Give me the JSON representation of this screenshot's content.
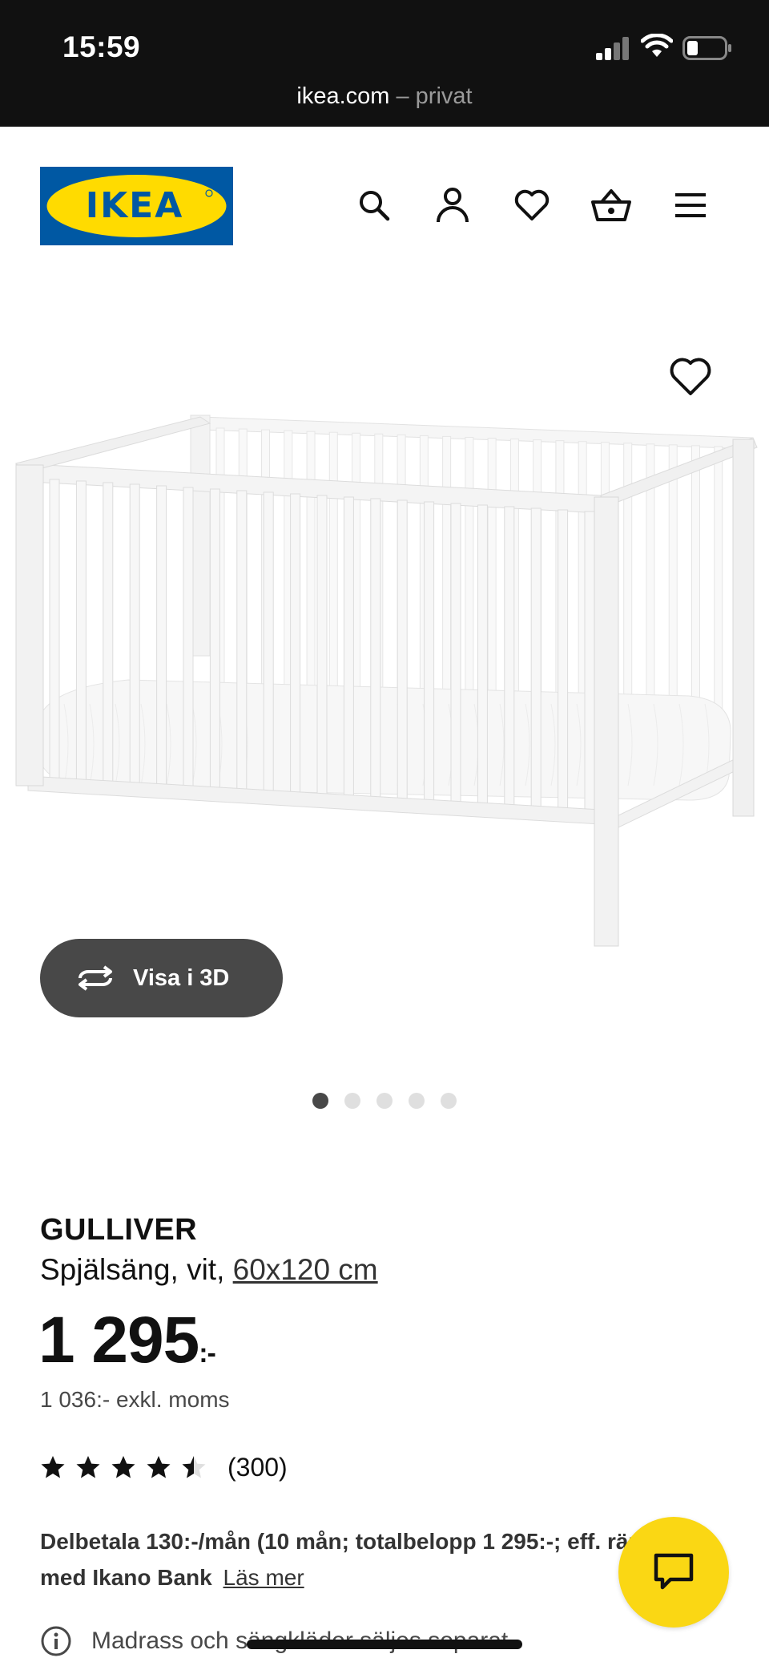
{
  "status_bar": {
    "time": "15:59",
    "url_host": "ikea.com",
    "url_suffix": " – privat",
    "icons": [
      "cell-signal-icon",
      "wifi-icon",
      "battery-icon"
    ]
  },
  "header": {
    "logo_text": "IKEA",
    "icons": [
      "search-icon",
      "user-icon",
      "heart-icon",
      "basket-icon",
      "menu-icon"
    ]
  },
  "gallery": {
    "view_3d_label": "Visa i 3D",
    "slide_count": 5,
    "active_slide": 1
  },
  "product": {
    "name": "GULLIVER",
    "description": "Spjälsäng, vit,",
    "size_link": "60x120 cm",
    "price": "1 295",
    "price_suffix": ":-",
    "price_excl_vat": "1 036:- exkl. moms",
    "rating_stars": 4.5,
    "rating_max": 5,
    "review_count": "(300)",
    "financing_text": "Delbetala 130:-/mån (10 mån; totalbelopp 1 295:-; eff. ränta 0%) med Ikano Bank",
    "financing_link": "Läs mer",
    "note": "Madrass och sängkläder säljes separat."
  },
  "colors": {
    "ikea_blue": "#0058a3",
    "ikea_yellow": "#ffdb00",
    "chat_yellow": "#fad714",
    "dark_grey": "#484848"
  }
}
